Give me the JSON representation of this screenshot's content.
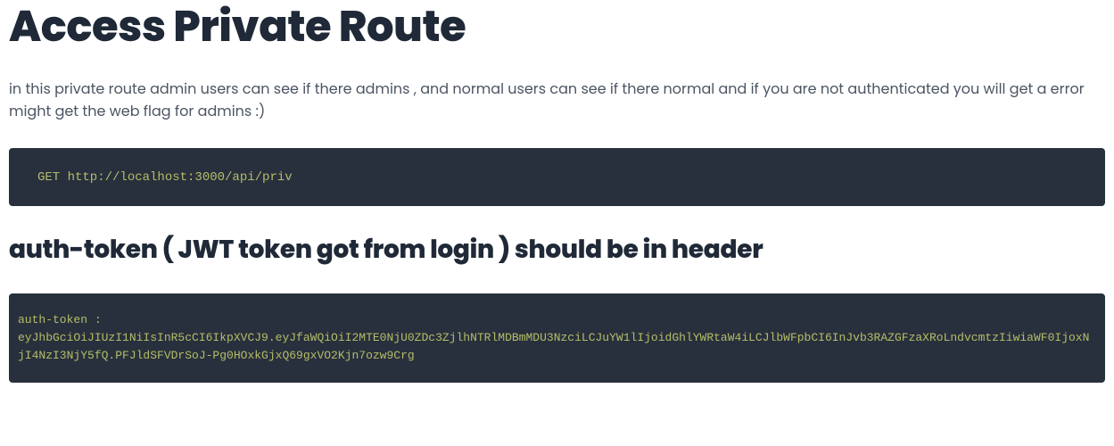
{
  "title": "Access Private Route",
  "description": "in this private route admin users can see if there admins , and normal users can see if there normal and if you are not authenticated you will get a error might get the web flag for admins :)",
  "request_line": "GET http://localhost:3000/api/priv",
  "subheading": "auth-token ( JWT token got from login ) should be in header",
  "token_block": "auth-token :\neyJhbGciOiJIUzI1NiIsInR5cCI6IkpXVCJ9.eyJfaWQiOiI2MTE0NjU0ZDc3ZjlhNTRlMDBmMDU3NzciLCJuYW1lIjoidGhlYWRtaW4iLCJlbWFpbCI6InJvb3RAZGFzaXRoLndvcmtzIiwiaWF0IjoxNjI4NzI3NjY5fQ.PFJldSFVDrSoJ-Pg0HOxkGjxQ69gxVO2Kjn7ozw9Crg"
}
